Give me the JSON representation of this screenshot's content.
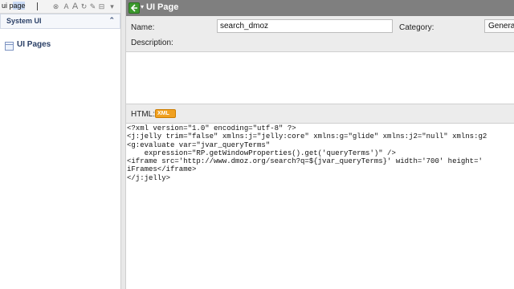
{
  "navigator": {
    "filter": {
      "value": "ui page"
    },
    "application": {
      "label": "System UI"
    },
    "modules": [
      {
        "label": "UI Pages"
      }
    ]
  },
  "form": {
    "title": "UI Page",
    "fields": {
      "name": {
        "label": "Name:",
        "value": "search_dmoz"
      },
      "category": {
        "label": "Category:",
        "value": "General"
      },
      "description": {
        "label": "Description:",
        "value": ""
      },
      "html": {
        "label": "HTML:",
        "badge": "XML"
      }
    },
    "html_code": [
      "<?xml version=\"1.0\" encoding=\"utf-8\" ?>",
      "<j:jelly trim=\"false\" xmlns:j=\"jelly:core\" xmlns:g=\"glide\" xmlns:j2=\"null\" xmlns:g2",
      "<g:evaluate var=\"jvar_queryTerms\"",
      "    expression=\"RP.getWindowProperties().get('queryTerms')\" />",
      "<iframe src='http://www.dmoz.org/search?q=${jvar_queryTerms}' width='700' height='",
      "iFrames</iframe>",
      "</j:jelly>"
    ]
  },
  "colors": {
    "title_bar": "#7f7f7f",
    "back_button": "#3b9a2c",
    "xml_badge": "#f0a020",
    "form_background": "#ececec",
    "nav_text": "#2a3f66"
  }
}
